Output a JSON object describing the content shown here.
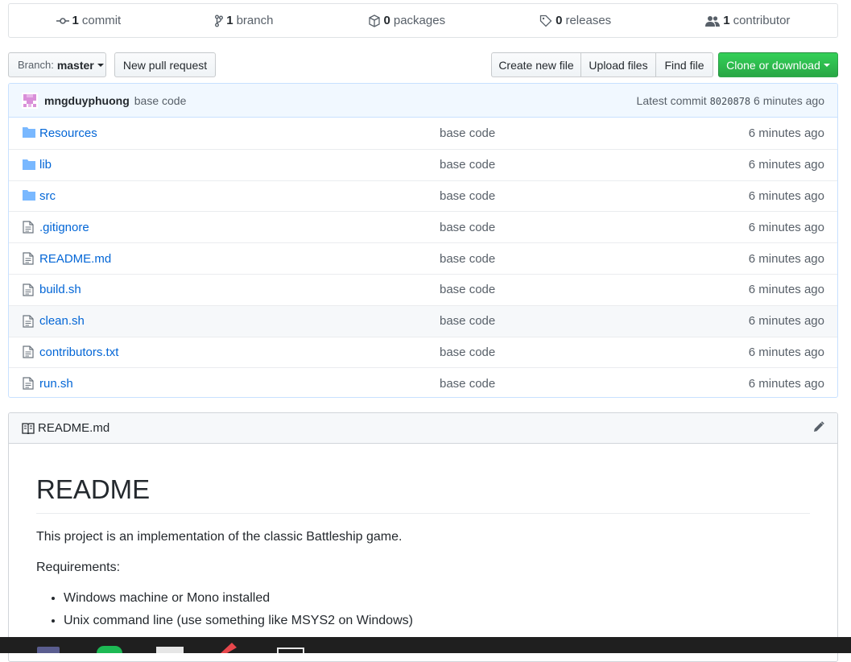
{
  "summary": {
    "commits": {
      "num": "1",
      "label": "commit"
    },
    "branches": {
      "num": "1",
      "label": "branch"
    },
    "packages": {
      "num": "0",
      "label": "packages"
    },
    "releases": {
      "num": "0",
      "label": "releases"
    },
    "contributors": {
      "num": "1",
      "label": "contributor"
    }
  },
  "toolbar": {
    "branch_prefix": "Branch:",
    "branch_name": "master",
    "new_pr": "New pull request",
    "create_file": "Create new file",
    "upload": "Upload files",
    "find": "Find file",
    "clone": "Clone or download"
  },
  "commit": {
    "author": "mngduyphuong",
    "message": "base code",
    "latest_label": "Latest commit",
    "sha": "8020878",
    "age": "6 minutes ago"
  },
  "files": [
    {
      "name": "Resources",
      "type": "folder",
      "message": "base code",
      "age": "6 minutes ago"
    },
    {
      "name": "lib",
      "type": "folder",
      "message": "base code",
      "age": "6 minutes ago"
    },
    {
      "name": "src",
      "type": "folder",
      "message": "base code",
      "age": "6 minutes ago"
    },
    {
      "name": ".gitignore",
      "type": "file",
      "message": "base code",
      "age": "6 minutes ago"
    },
    {
      "name": "README.md",
      "type": "file",
      "message": "base code",
      "age": "6 minutes ago"
    },
    {
      "name": "build.sh",
      "type": "file",
      "message": "base code",
      "age": "6 minutes ago"
    },
    {
      "name": "clean.sh",
      "type": "file",
      "message": "base code",
      "age": "6 minutes ago"
    },
    {
      "name": "contributors.txt",
      "type": "file",
      "message": "base code",
      "age": "6 minutes ago"
    },
    {
      "name": "run.sh",
      "type": "file",
      "message": "base code",
      "age": "6 minutes ago"
    }
  ],
  "readme": {
    "filename": "README.md",
    "heading": "README",
    "intro": "This project is an implementation of the classic Battleship game.",
    "req_label": "Requirements:",
    "requirements": [
      "Windows machine or Mono installed",
      "Unix command line (use something like MSYS2 on Windows)"
    ]
  },
  "colors": {
    "link": "#0366d6",
    "green_button": "#28a745",
    "commit_bar_bg": "#f1f8ff"
  }
}
